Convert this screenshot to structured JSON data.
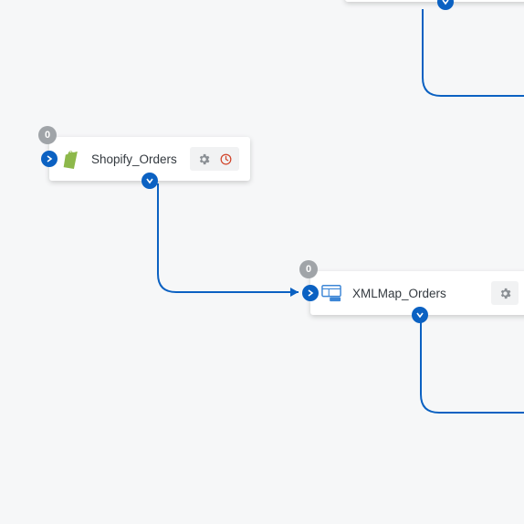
{
  "nodes": {
    "top_partial": {
      "visible_edge_only": true
    },
    "shopify": {
      "label": "Shopify_Orders",
      "badge_count": "0",
      "icon": "shopify-icon",
      "has_gear": true,
      "has_clock_alert": true
    },
    "xmlmap": {
      "label": "XMLMap_Orders",
      "badge_count": "0",
      "icon": "xml-map-icon",
      "has_gear": true,
      "has_clock_alert": false
    }
  },
  "colors": {
    "connector": "#0b61c2",
    "port_fill": "#0b61c2",
    "badge_fill": "#a0a4a8",
    "gear": "#8a8f94",
    "alert": "#d1452b",
    "shopify_green": "#8db84a",
    "xml_blue": "#3d86d6"
  }
}
